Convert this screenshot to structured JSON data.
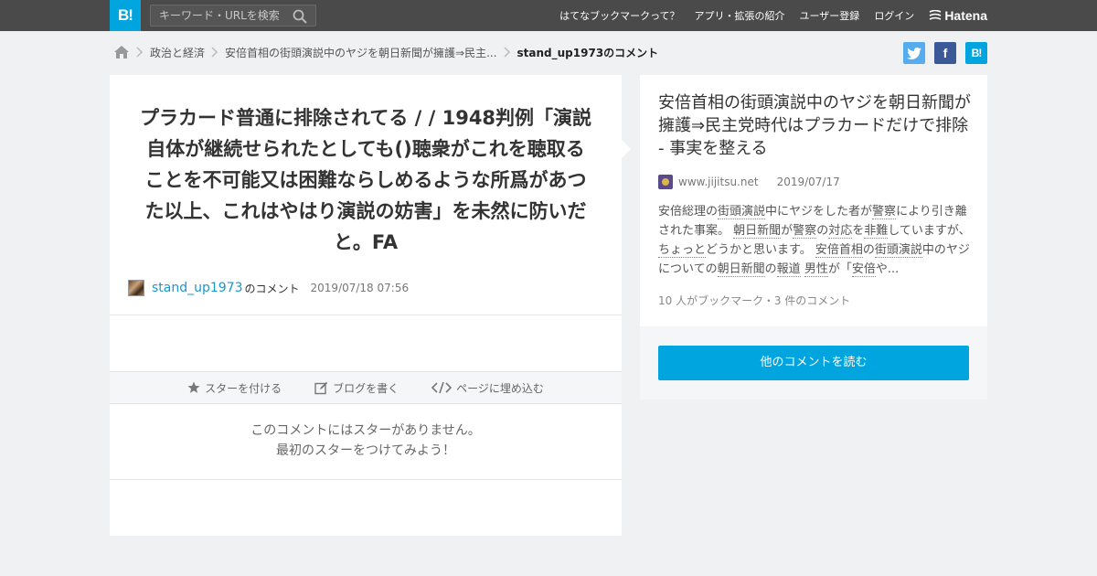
{
  "header": {
    "logo": "B!",
    "search_placeholder": "キーワード・URLを検索",
    "nav": [
      "はてなブックマークって？",
      "アプリ・拡張の紹介",
      "ユーザー登録",
      "ログイン"
    ],
    "brand": "Hatena"
  },
  "breadcrumb": {
    "items": [
      "政治と経済",
      "安倍首相の街頭演説中のヤジを朝日新聞が擁護⇒民主...",
      "stand_up1973のコメント"
    ]
  },
  "share": {
    "facebook": "f",
    "hatena": "B!"
  },
  "comment": {
    "text": "プラカード普通に排除されてる / / 1948判例「演説自体が継続せられたとしても()聴衆がこれを聴取ることを不可能又は困難ならしめるような所爲があつた以上、これはやはり演説の妨害」を未然に防いだと。FA",
    "user": "stand_up1973",
    "user_suffix": "のコメント",
    "datetime": "2019/07/18 07:56"
  },
  "actions": {
    "star": "スターを付ける",
    "blog": "ブログを書く",
    "embed": "ページに埋め込む"
  },
  "stars": {
    "line1": "このコメントにはスターがありません。",
    "line2": "最初のスターをつけてみよう！"
  },
  "entry": {
    "title": "安倍首相の街頭演説中のヤジを朝日新聞が擁護⇒民主党時代はプラカードだけで排除 - 事実を整える",
    "domain": "www.jijitsu.net",
    "date": "2019/07/17",
    "summary": {
      "p1": "安倍総理の",
      "k1": "街頭演説",
      "p2": "中にヤジをした者が",
      "k2": "警察",
      "p3": "により引き離された事案。 ",
      "k3": "朝日新聞",
      "p4": "が",
      "k4": "警察",
      "p5": "の",
      "k5": "対応",
      "p6": "を",
      "k6": "非難",
      "p7": "していますが、",
      "k7": "ちょっと",
      "p8": "どうかと思います。 ",
      "k8": "安倍首相",
      "p9": "の",
      "k9": "街頭演説",
      "p10": "中のヤジについての",
      "k10": "朝日新聞",
      "p11": "の",
      "k11": "報道",
      "p12": " ",
      "k12": "男性",
      "p13": "が「",
      "k13": "安倍",
      "p14": "や..."
    },
    "counts": "10 人がブックマーク・3 件のコメント",
    "read_more": "他のコメントを読む"
  },
  "colors": {
    "topbar": "#4a4a4a",
    "accent": "#00a4de",
    "username": "#1a98c9",
    "twitter": "#55acee",
    "facebook": "#3b5998"
  }
}
